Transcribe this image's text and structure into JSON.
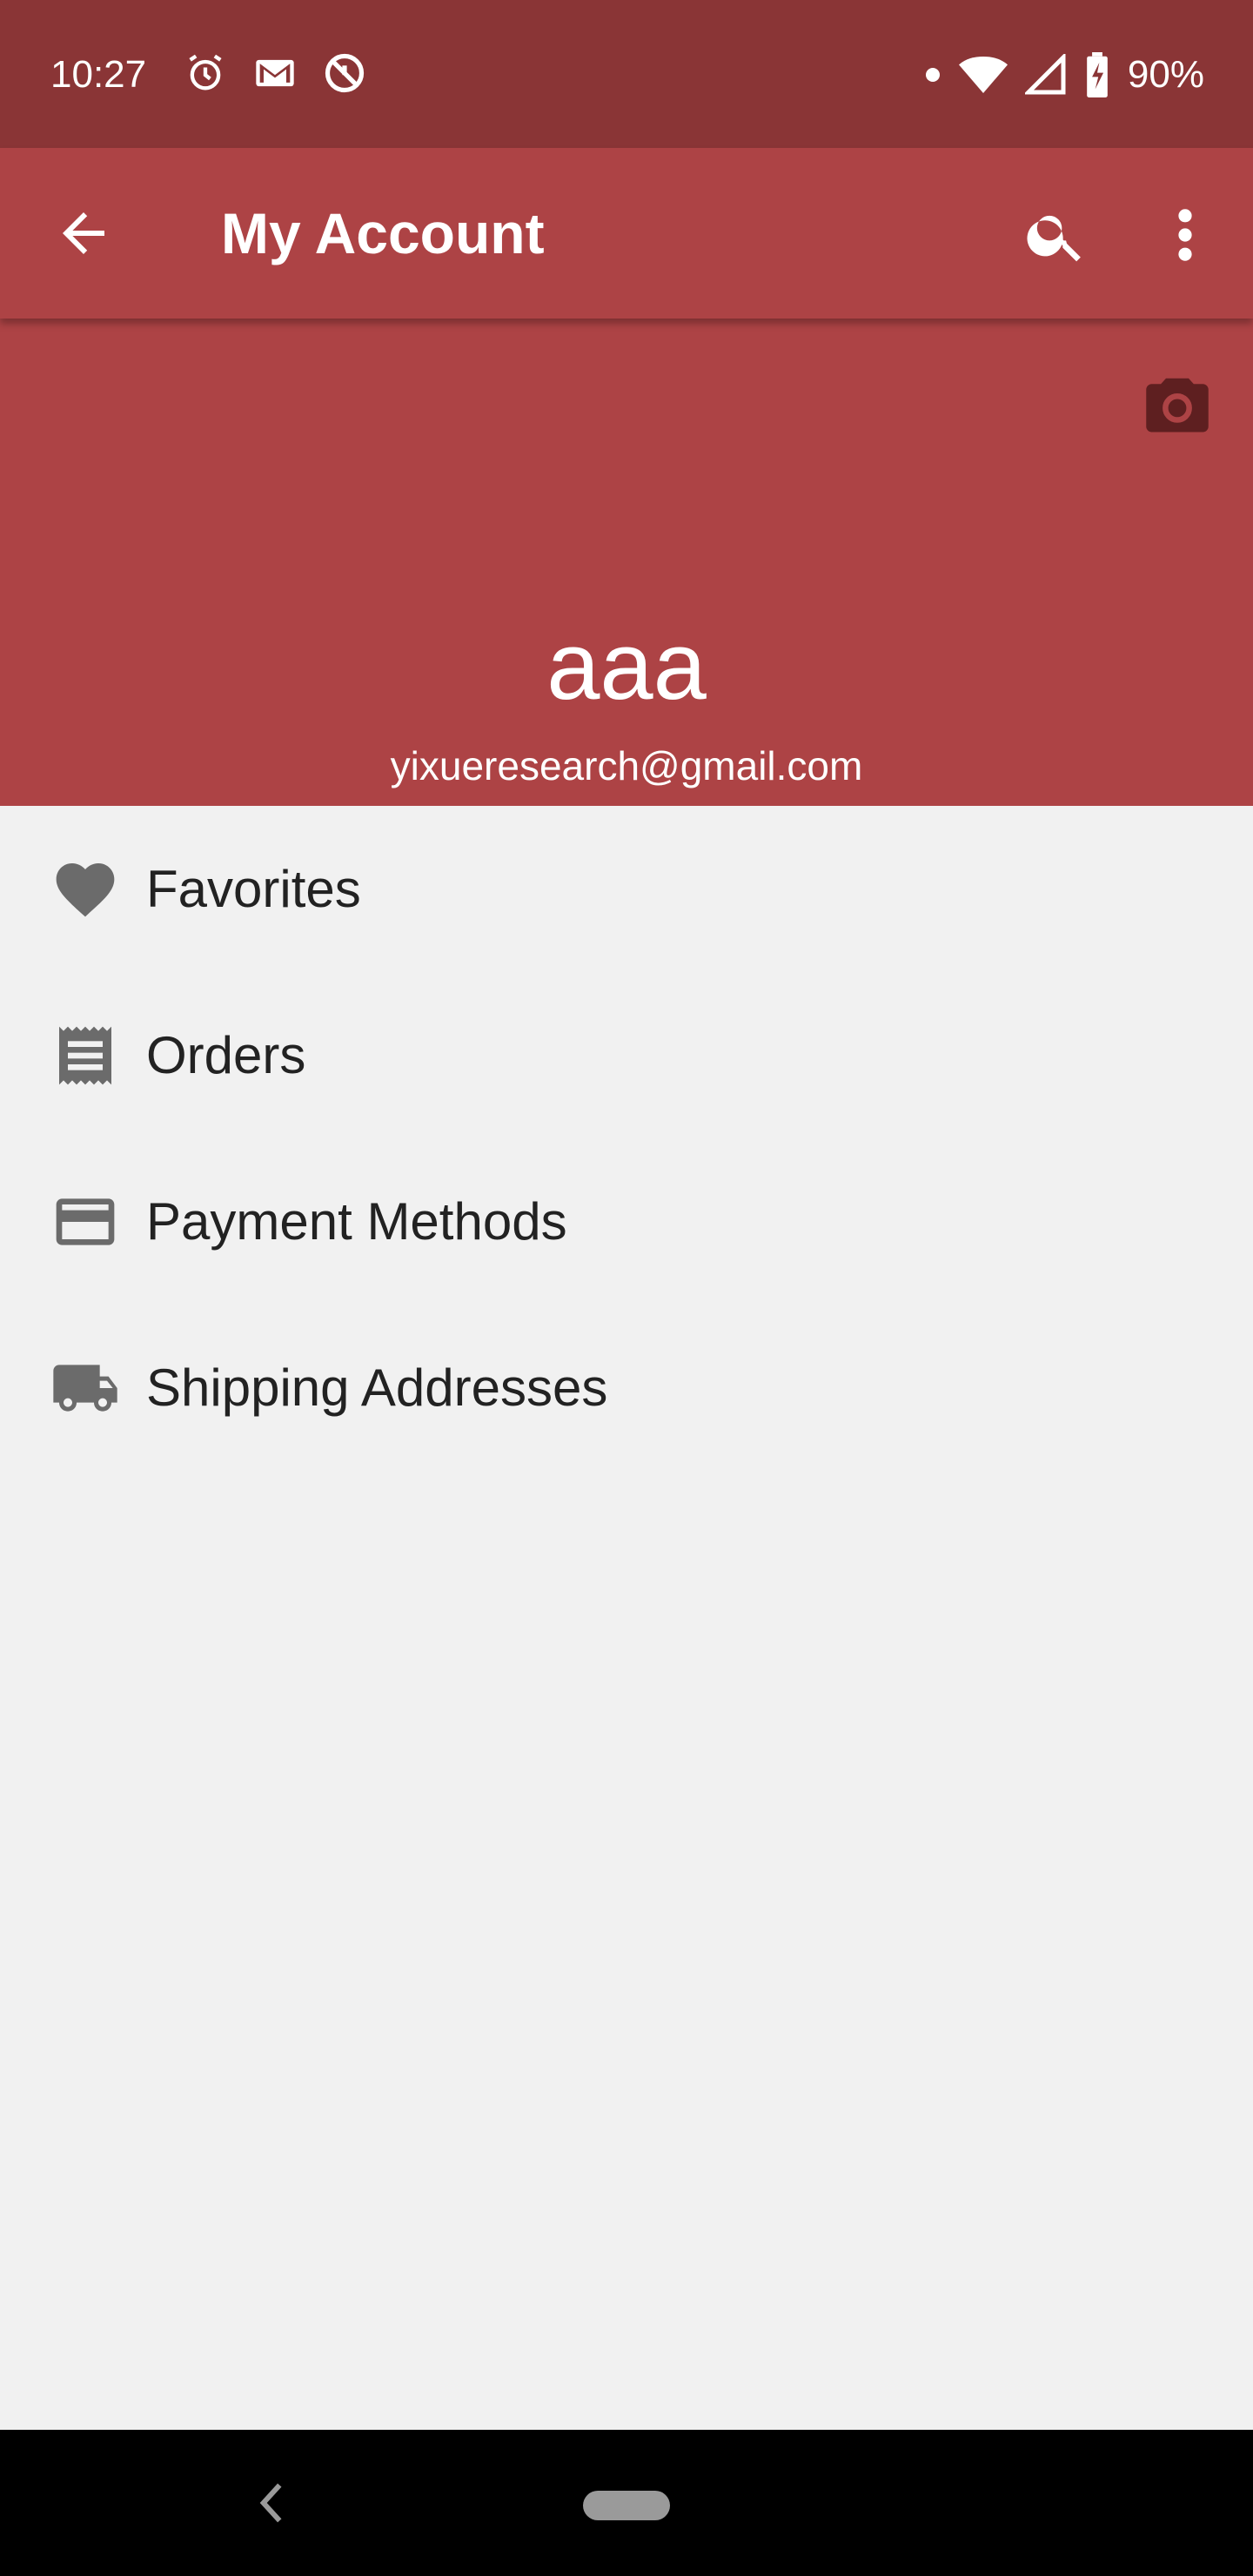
{
  "status_bar": {
    "time": "10:27",
    "battery": "90%",
    "left_icons": [
      "alarm-icon",
      "gmail-icon",
      "no-disturb-icon"
    ],
    "right_icons": [
      "dot-icon",
      "wifi-icon",
      "signal-icon",
      "battery-charging-icon"
    ]
  },
  "app_bar": {
    "title": "My Account",
    "back_icon": "arrow-back-icon",
    "search_icon": "search-icon",
    "more_icon": "more-vert-icon"
  },
  "profile": {
    "name": "aaa",
    "email": "yixueresearch@gmail.com",
    "camera_icon": "camera-icon"
  },
  "menu": {
    "items": [
      {
        "label": "Favorites",
        "icon": "heart-icon"
      },
      {
        "label": "Orders",
        "icon": "receipt-icon"
      },
      {
        "label": "Payment Methods",
        "icon": "credit-card-icon"
      },
      {
        "label": "Shipping Addresses",
        "icon": "truck-icon"
      }
    ]
  },
  "colors": {
    "status_bar": "#8a3536",
    "app_bar": "#ad4345",
    "background": "#f1f1f1",
    "icon_gray": "#6b6b6b",
    "camera_dark": "#5e1f20"
  }
}
